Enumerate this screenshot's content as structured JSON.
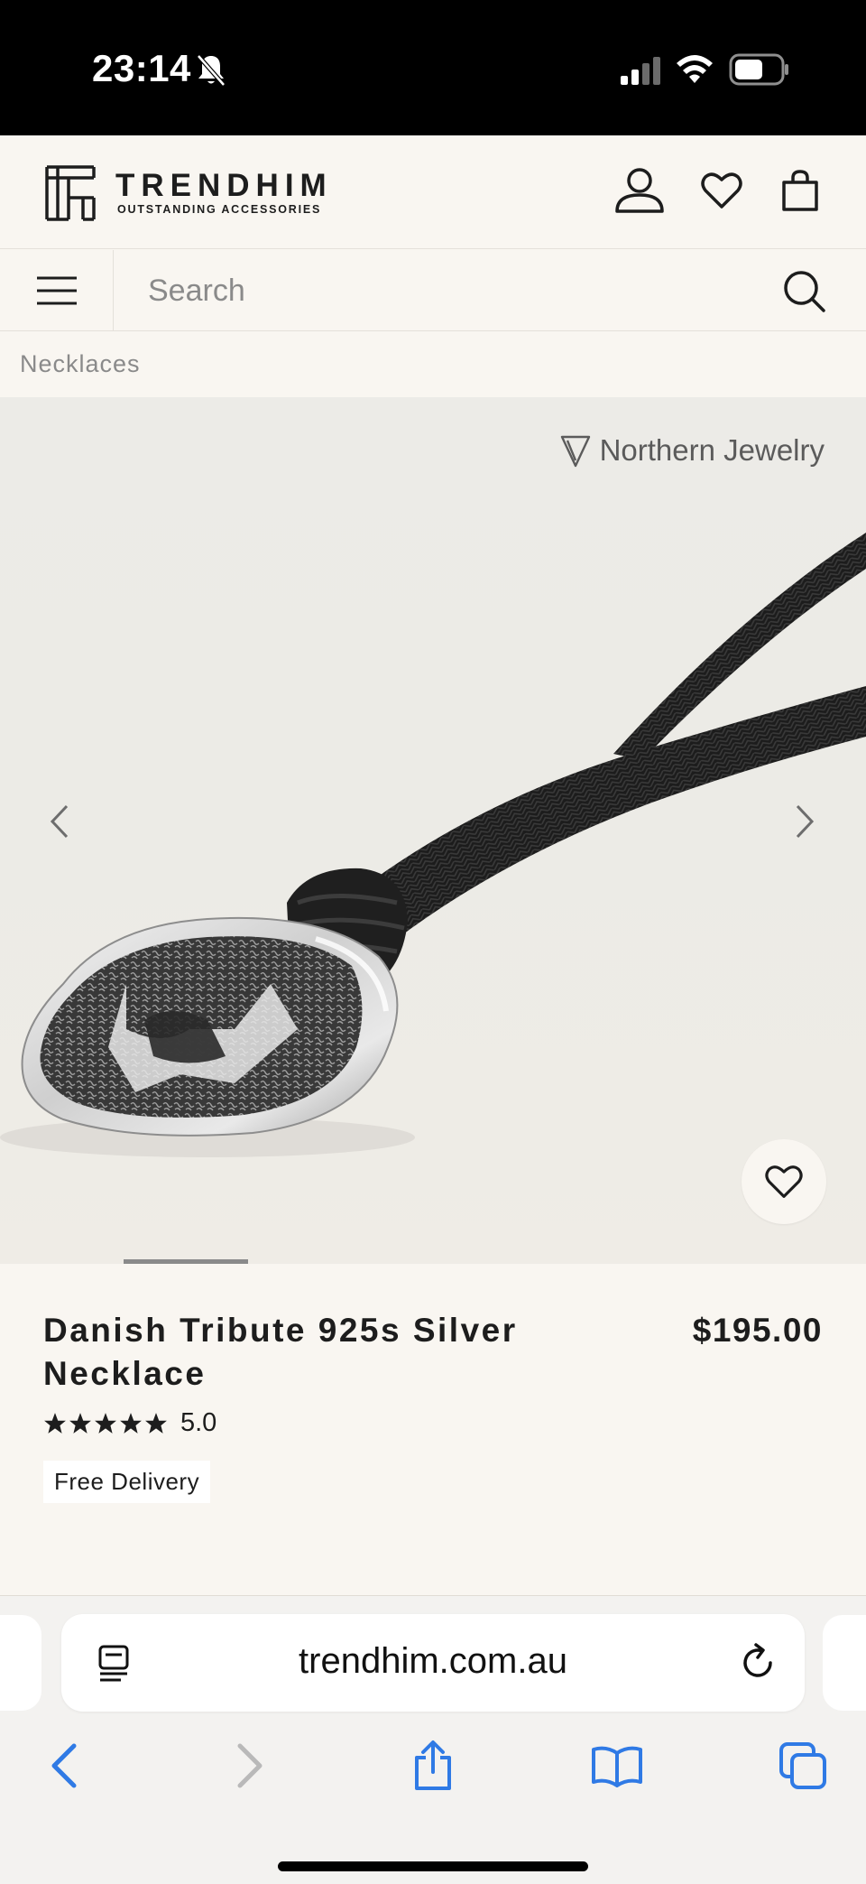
{
  "status_bar": {
    "time": "23:14",
    "icons": [
      "bell-slash-icon",
      "signal-icon",
      "wifi-icon",
      "battery-icon"
    ]
  },
  "header": {
    "logo_name": "TRENDHIM",
    "logo_tagline": "OUTSTANDING ACCESSORIES",
    "icons": [
      "account-icon",
      "heart-icon",
      "bag-icon"
    ]
  },
  "search": {
    "placeholder": "Search",
    "value": ""
  },
  "breadcrumb": "Necklaces",
  "gallery": {
    "brand": "Northern Jewelry",
    "current_slide_progress": 0.14
  },
  "product": {
    "title": "Danish Tribute 925s Silver Necklace",
    "price": "$195.00",
    "rating": "5.0",
    "stars": 5,
    "delivery": "Free Delivery"
  },
  "browser": {
    "url": "trendhim.com.au",
    "accent_color": "#2f7ae5"
  }
}
